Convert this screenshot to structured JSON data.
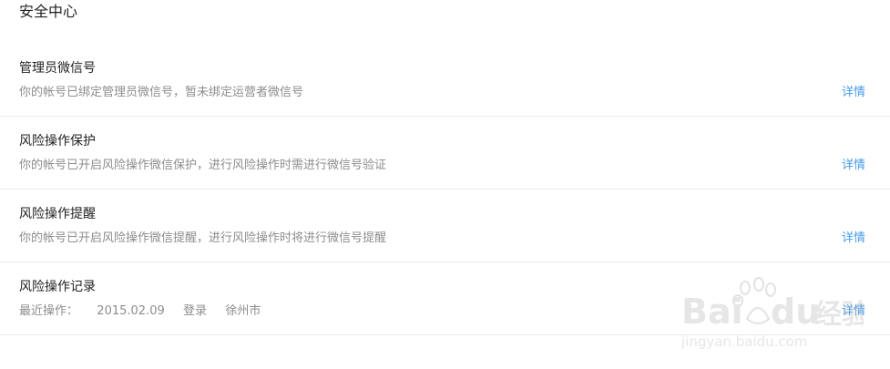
{
  "page": {
    "title": "安全中心"
  },
  "sections": [
    {
      "title": "管理员微信号",
      "description": "你的帐号已绑定管理员微信号，暂未绑定运营者微信号",
      "link_label": "详情"
    },
    {
      "title": "风险操作保护",
      "description": "你的帐号已开启风险操作微信保护，进行风险操作时需进行微信号验证",
      "link_label": "详情"
    },
    {
      "title": "风险操作提醒",
      "description": "你的帐号已开启风险操作微信提醒，进行风险操作时将进行微信号提醒",
      "link_label": "详情"
    },
    {
      "title": "风险操作记录",
      "recent": {
        "label": "最近操作：",
        "date": "2015.02.09",
        "action": "登录",
        "location": "徐州市"
      },
      "link_label": "详情"
    }
  ],
  "watermark": {
    "brand": "Bai du 经验",
    "url": "jingyan.baidu.com"
  },
  "colors": {
    "link": "#459ae9",
    "muted_text": "#8d8d8d",
    "divider": "#e7e7eb"
  }
}
